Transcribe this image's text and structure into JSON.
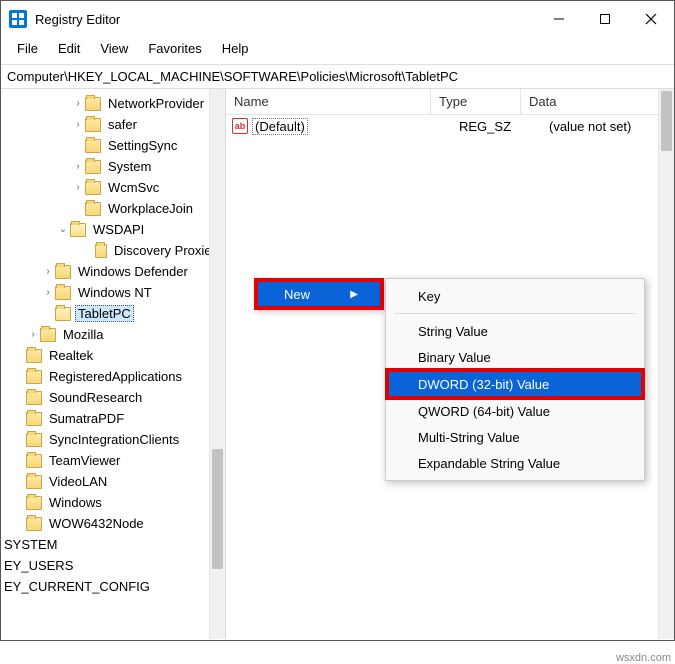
{
  "title": "Registry Editor",
  "menubar": {
    "file": "File",
    "edit": "Edit",
    "view": "View",
    "favorites": "Favorites",
    "help": "Help"
  },
  "address": "Computer\\HKEY_LOCAL_MACHINE\\SOFTWARE\\Policies\\Microsoft\\TabletPC",
  "tree": {
    "items": [
      {
        "indent": 70,
        "chev": ">",
        "label": "NetworkProvider"
      },
      {
        "indent": 70,
        "chev": ">",
        "label": "safer"
      },
      {
        "indent": 70,
        "chev": "",
        "label": "SettingSync"
      },
      {
        "indent": 70,
        "chev": ">",
        "label": "System"
      },
      {
        "indent": 70,
        "chev": ">",
        "label": "WcmSvc"
      },
      {
        "indent": 70,
        "chev": "",
        "label": "WorkplaceJoin"
      },
      {
        "indent": 55,
        "chev": "v",
        "label": "WSDAPI",
        "open": true
      },
      {
        "indent": 84,
        "chev": "",
        "label": "Discovery Proxies"
      },
      {
        "indent": 40,
        "chev": ">",
        "label": "Windows Defender"
      },
      {
        "indent": 40,
        "chev": ">",
        "label": "Windows NT"
      },
      {
        "indent": 40,
        "chev": "",
        "label": "TabletPC",
        "selected": true,
        "open": true
      },
      {
        "indent": 25,
        "chev": ">",
        "label": "Mozilla"
      },
      {
        "indent": 11,
        "chev": "",
        "label": "Realtek",
        "root": true
      },
      {
        "indent": 11,
        "chev": "",
        "label": "RegisteredApplications",
        "root": true
      },
      {
        "indent": 11,
        "chev": "",
        "label": "SoundResearch",
        "root": true
      },
      {
        "indent": 11,
        "chev": "",
        "label": "SumatraPDF",
        "root": true
      },
      {
        "indent": 11,
        "chev": "",
        "label": "SyncIntegrationClients",
        "root": true
      },
      {
        "indent": 11,
        "chev": "",
        "label": "TeamViewer",
        "root": true
      },
      {
        "indent": 11,
        "chev": "",
        "label": "VideoLAN",
        "root": true
      },
      {
        "indent": 11,
        "chev": "",
        "label": "Windows",
        "root": true
      },
      {
        "indent": 11,
        "chev": "",
        "label": "WOW6432Node",
        "root": true
      },
      {
        "indent": 0,
        "chev": "",
        "label": "SYSTEM",
        "plain": true
      },
      {
        "indent": 0,
        "chev": "",
        "label": "EY_USERS",
        "plain": true
      },
      {
        "indent": 0,
        "chev": "",
        "label": "EY_CURRENT_CONFIG",
        "plain": true
      }
    ]
  },
  "list": {
    "headers": {
      "name": "Name",
      "type": "Type",
      "data": "Data"
    },
    "rows": [
      {
        "icon": "ab",
        "name": "(Default)",
        "type": "REG_SZ",
        "data": "(value not set)"
      }
    ]
  },
  "context1": {
    "new": "New"
  },
  "context2": {
    "key": "Key",
    "string": "String Value",
    "binary": "Binary Value",
    "dword": "DWORD (32-bit) Value",
    "qword": "QWORD (64-bit) Value",
    "multi": "Multi-String Value",
    "expand": "Expandable String Value"
  },
  "watermark": "wsxdn.com"
}
